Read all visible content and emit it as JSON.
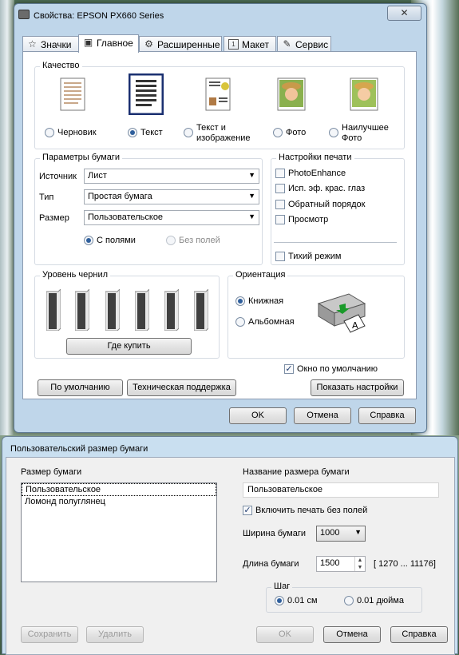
{
  "window1": {
    "title": "Свойства: EPSON PX660 Series",
    "close_symbol": "✕",
    "tabs": [
      {
        "label": "Значки",
        "icon": "star-icon"
      },
      {
        "label": "Главное",
        "icon": "printer-icon"
      },
      {
        "label": "Расширенные",
        "icon": "gears-icon"
      },
      {
        "label": "Макет",
        "icon": "page-one-icon"
      },
      {
        "label": "Сервис",
        "icon": "wrench-icon"
      }
    ],
    "quality": {
      "title": "Качество",
      "options": [
        {
          "label": "Черновик",
          "selected": false
        },
        {
          "label": "Текст",
          "selected": true
        },
        {
          "label": "Текст и изображение",
          "selected": false
        },
        {
          "label": "Фото",
          "selected": false
        },
        {
          "label": "Наилучшее Фото",
          "selected": false
        }
      ]
    },
    "paper": {
      "title": "Параметры бумаги",
      "source_label": "Источник",
      "source_value": "Лист",
      "type_label": "Тип",
      "type_value": "Простая бумага",
      "size_label": "Размер",
      "size_value": "Пользовательское",
      "margins_label": "С полями",
      "borderless_label": "Без полей"
    },
    "print_settings": {
      "title": "Настройки печати",
      "items": [
        "PhotoEnhance",
        "Исп. эф. крас. глаз",
        "Обратный порядок",
        "Просмотр"
      ],
      "quiet_mode": "Тихий режим"
    },
    "ink": {
      "title": "Уровень чернил",
      "buy_button": "Где купить",
      "colors": [
        "#1a1a1a",
        "#1a1a1a",
        "#1a1a1a",
        "#1a1a1a",
        "#1a1a1a",
        "#1a1a1a"
      ]
    },
    "orientation": {
      "title": "Ориентация",
      "portrait": "Книжная",
      "landscape": "Альбомная"
    },
    "default_window_label": "Окно по умолчанию",
    "defaults_button": "По умолчанию",
    "support_button": "Техническая поддержка",
    "show_settings_button": "Показать настройки",
    "ok_button": "OK",
    "cancel_button": "Отмена",
    "help_button": "Справка",
    "accent_color": "#2f5f9c"
  },
  "window2": {
    "title": "Пользовательский размер бумаги",
    "paper_size_label": "Размер бумаги",
    "list": [
      "Пользовательское",
      "Ломонд полуглянец"
    ],
    "paper_name_label": "Название размера бумаги",
    "paper_name_value": "Пользовательское",
    "borderless_check": "Включить печать без полей",
    "width_label": "Ширина бумаги",
    "width_value": "1000",
    "length_label": "Длина бумаги",
    "length_value": "1500",
    "length_range": "[ 1270 ... 11176]",
    "step_title": "Шаг",
    "step_cm": "0.01 см",
    "step_inch": "0.01 дюйма",
    "save_button": "Сохранить",
    "delete_button": "Удалить",
    "ok_button": "OK",
    "cancel_button": "Отмена",
    "help_button": "Справка"
  }
}
